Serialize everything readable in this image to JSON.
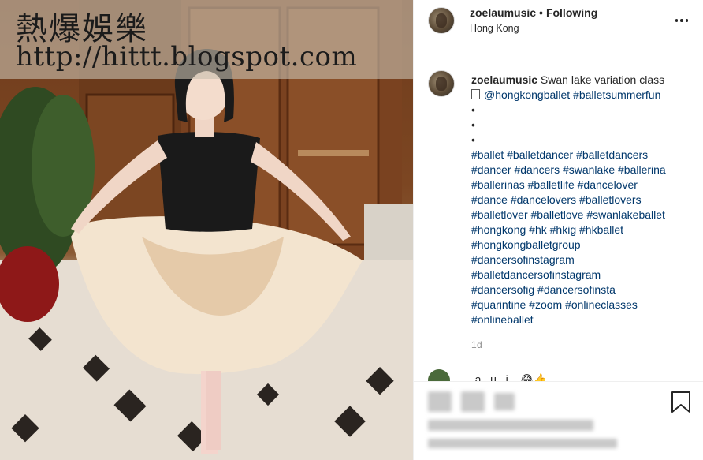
{
  "watermark": {
    "title": "熱爆娛樂",
    "url": "http://hittt.blogspot.com"
  },
  "header": {
    "username": "zoelaumusic",
    "separator": "•",
    "follow_status": "Following",
    "location": "Hong Kong",
    "more_icon": "more-options-icon"
  },
  "caption": {
    "username": "zoelaumusic",
    "text": "Swan lake variation class",
    "mention_line": "@hongkongballet #balletsummerfun",
    "bullets": [
      "•",
      "•",
      "•"
    ],
    "hashtag_lines": [
      "#ballet #balletdancer #balletdancers",
      "#dancer #dancers #swanlake #ballerina",
      "#ballerinas #balletlife #dancelover",
      "#dance #dancelovers #balletlovers",
      "#balletlover #balletlove #swanlakeballet",
      "#hongkong #hk #hkig #hkballet",
      "#hongkongballetgroup",
      "#dancersofinstagram",
      "#balletdancersofinstagram",
      "#dancersofig #dancersofinsta",
      "#quarintine #zoom #onlineclasses",
      "#onlineballet"
    ],
    "timestamp": "1d"
  },
  "next_comment": {
    "text": "...a...u...i... 😂👍"
  },
  "actions": {
    "bookmark_icon": "bookmark-icon"
  },
  "colors": {
    "text": "#262626",
    "link": "#00376b",
    "muted": "#8e8e8e",
    "border": "#efefef"
  }
}
